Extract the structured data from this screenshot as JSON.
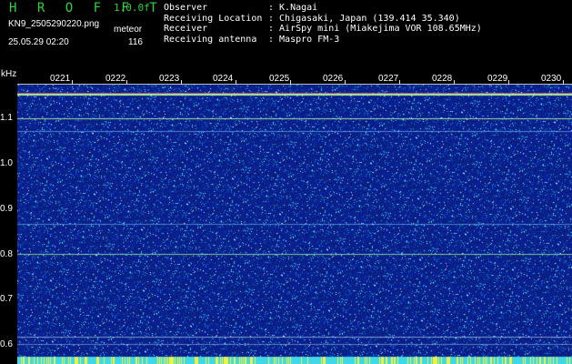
{
  "header": {
    "brand": "H R O F F T",
    "version": "1.0.0f",
    "file_name": "KN9_2505290220.png",
    "meteor_label": "meteor",
    "datetime": "25.05.29 02:20",
    "meteor_count": "116"
  },
  "info": [
    {
      "key": "Observer",
      "value": ": K.Nagai"
    },
    {
      "key": "Receiving Location",
      "value": ": Chigasaki, Japan (139.414 35.340)"
    },
    {
      "key": "Receiver",
      "value": ": AirSpy mini (Miakejima VOR 108.65MHz)"
    },
    {
      "key": "Receiving antenna",
      "value": ": Maspro FM-3"
    }
  ],
  "axis": {
    "unit": "kHz",
    "y_labels": [
      "1.1",
      "1.0",
      "0.9",
      "0.8",
      "0.7",
      "0.6"
    ],
    "time_labels": [
      "0221",
      "0222",
      "0223",
      "0224",
      "0225",
      "0226",
      "0227",
      "0228",
      "0229",
      "0230"
    ]
  },
  "colors": {
    "background_noise": "#10208c",
    "header_green": "#2ad43a",
    "carrier_line": "#c8ffb0"
  }
}
